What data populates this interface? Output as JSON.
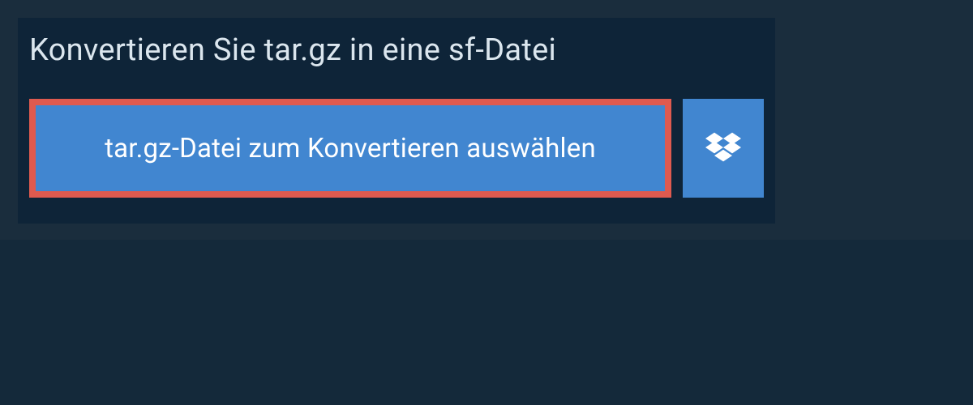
{
  "title": "Konvertieren Sie tar.gz in eine sf-Datei",
  "select_button_label": "tar.gz-Datei zum Konvertieren auswählen",
  "dropbox_icon": "dropbox-icon"
}
